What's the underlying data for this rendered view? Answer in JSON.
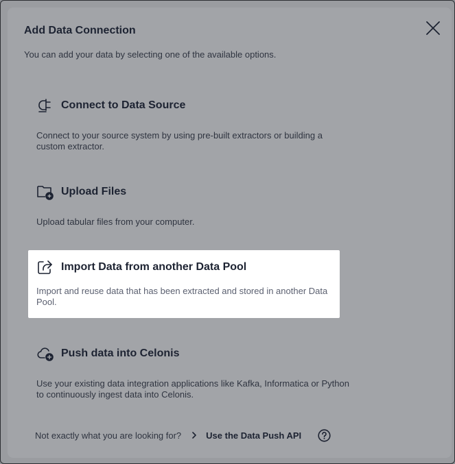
{
  "dialog": {
    "title": "Add Data Connection",
    "subtitle": "You can add your data by selecting one of the available options."
  },
  "options": [
    {
      "icon": "plug-icon",
      "title": "Connect to Data Source",
      "description": "Connect to your source system by using pre-built extractors or building a custom extractor.",
      "highlighted": false
    },
    {
      "icon": "folder-add-icon",
      "title": "Upload Files",
      "description": "Upload tabular files from your computer.",
      "highlighted": false
    },
    {
      "icon": "share-export-icon",
      "title": "Import Data from another Data Pool",
      "description": "Import and reuse data that has been extracted and stored in another Data Pool.",
      "highlighted": true
    },
    {
      "icon": "cloud-add-icon",
      "title": "Push data into Celonis",
      "description": "Use your existing data integration applications like Kafka, Informatica or Python to continuously ingest data into Celonis.",
      "highlighted": false
    }
  ],
  "footer": {
    "prompt": "Not exactly what you are looking for?",
    "link_label": "Use the Data Push API"
  },
  "colors": {
    "overlay": "#9a9ca0",
    "text_dark": "#1d2332",
    "highlight_bg": "#ffffff"
  }
}
